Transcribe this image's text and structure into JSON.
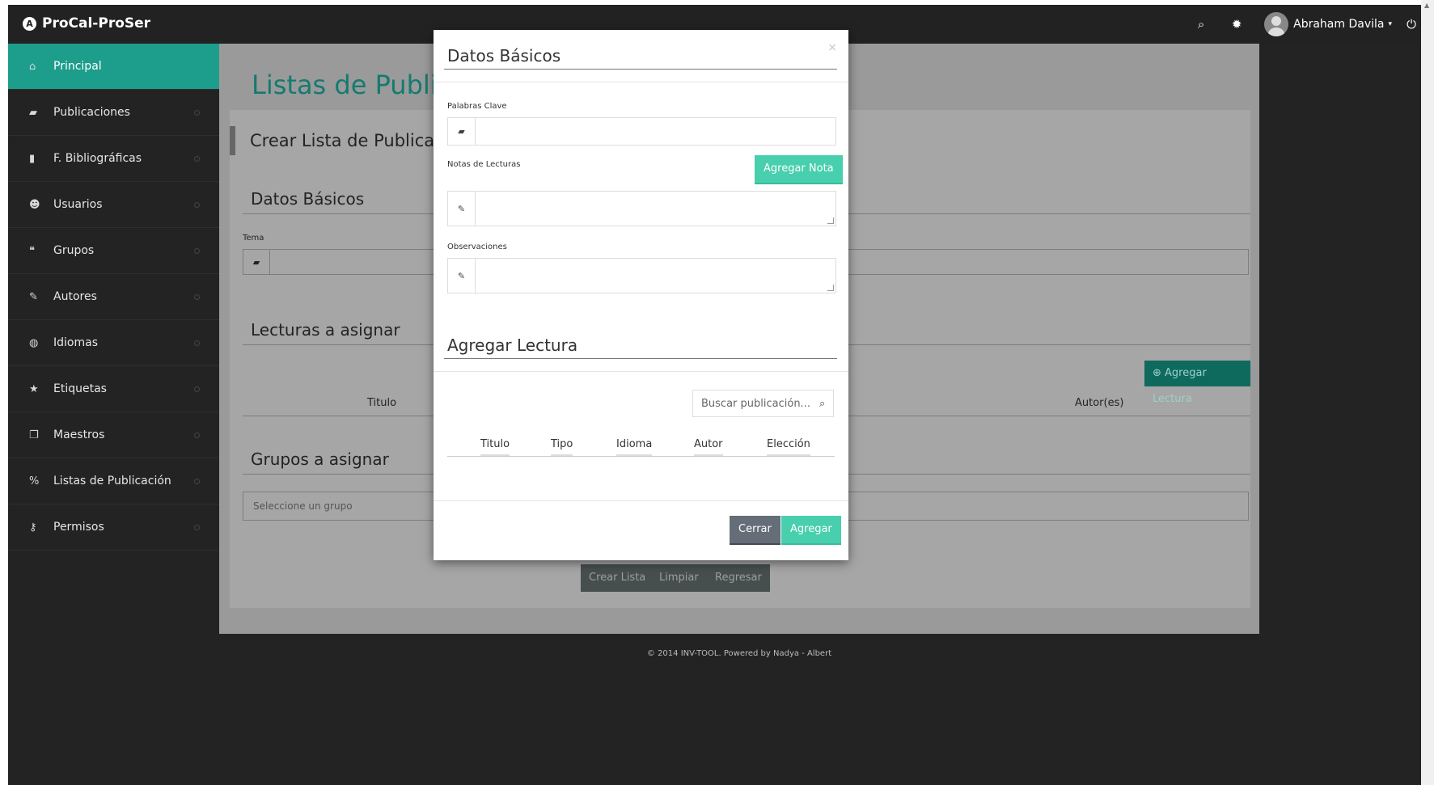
{
  "app": {
    "brand": "ProCal-ProSer",
    "brand_logo": "A"
  },
  "navbar": {
    "search_icon": "search-icon",
    "settings_icon": "gear-icon",
    "user_name": "Abraham Davila",
    "caret": "▾",
    "power_icon": "power-icon"
  },
  "sidebar": {
    "items": [
      {
        "label": "Principal",
        "icon": "home-icon",
        "glyph": "⌂"
      },
      {
        "label": "Publicaciones",
        "icon": "book-icon",
        "glyph": "▰"
      },
      {
        "label": "F. Bibliográficas",
        "icon": "file-icon",
        "glyph": "▮"
      },
      {
        "label": "Usuarios",
        "icon": "users-icon",
        "glyph": "☻"
      },
      {
        "label": "Grupos",
        "icon": "comments-icon",
        "glyph": "❝"
      },
      {
        "label": "Autores",
        "icon": "edit-icon",
        "glyph": "✎"
      },
      {
        "label": "Idiomas",
        "icon": "globe-icon",
        "glyph": "◍"
      },
      {
        "label": "Etiquetas",
        "icon": "star-icon",
        "glyph": "★"
      },
      {
        "label": "Maestros",
        "icon": "copy-icon",
        "glyph": "❐"
      },
      {
        "label": "Listas de Publicación",
        "icon": "link-icon",
        "glyph": "%"
      },
      {
        "label": "Permisos",
        "icon": "key-icon",
        "glyph": "⚷"
      }
    ]
  },
  "main": {
    "page_title": "Listas de Publica",
    "panel_heading": "Crear Lista de Publicació",
    "datos_basicos": "Datos Básicos",
    "tema_label": "Tema",
    "lecturas_title": "Lecturas a asignar",
    "agregar_lectura_btn": "Agregar Lectura",
    "col_titulo": "Titulo",
    "col_autores": "Autor(es)",
    "grupos_title": "Grupos a asignar",
    "grupo_placeholder": "Seleccione un grupo",
    "btn_crear": "Crear Lista",
    "btn_limpiar": "Limpiar",
    "btn_regresar": "Regresar"
  },
  "footer": {
    "text": "© 2014 INV-TOOL. Powered by Nadya - Albert"
  },
  "modal": {
    "close": "×",
    "title": "Datos Básicos",
    "palabras_label": "Palabras Clave",
    "notas_label": "Notas de Lecturas",
    "agregar_nota_btn": "Agregar Nota",
    "observaciones_label": "Observaciones",
    "agregar_lectura_title": "Agregar Lectura",
    "search_placeholder": "Buscar publicación...",
    "columns": [
      "Titulo",
      "Tipo",
      "Idioma",
      "Autor",
      "Elección"
    ],
    "btn_cerrar": "Cerrar",
    "btn_agregar": "Agregar"
  },
  "colors": {
    "accent": "#48cfad",
    "sidebar_active": "#1d9d8c",
    "navbar": "#222222",
    "gray_button": "#656d78"
  }
}
